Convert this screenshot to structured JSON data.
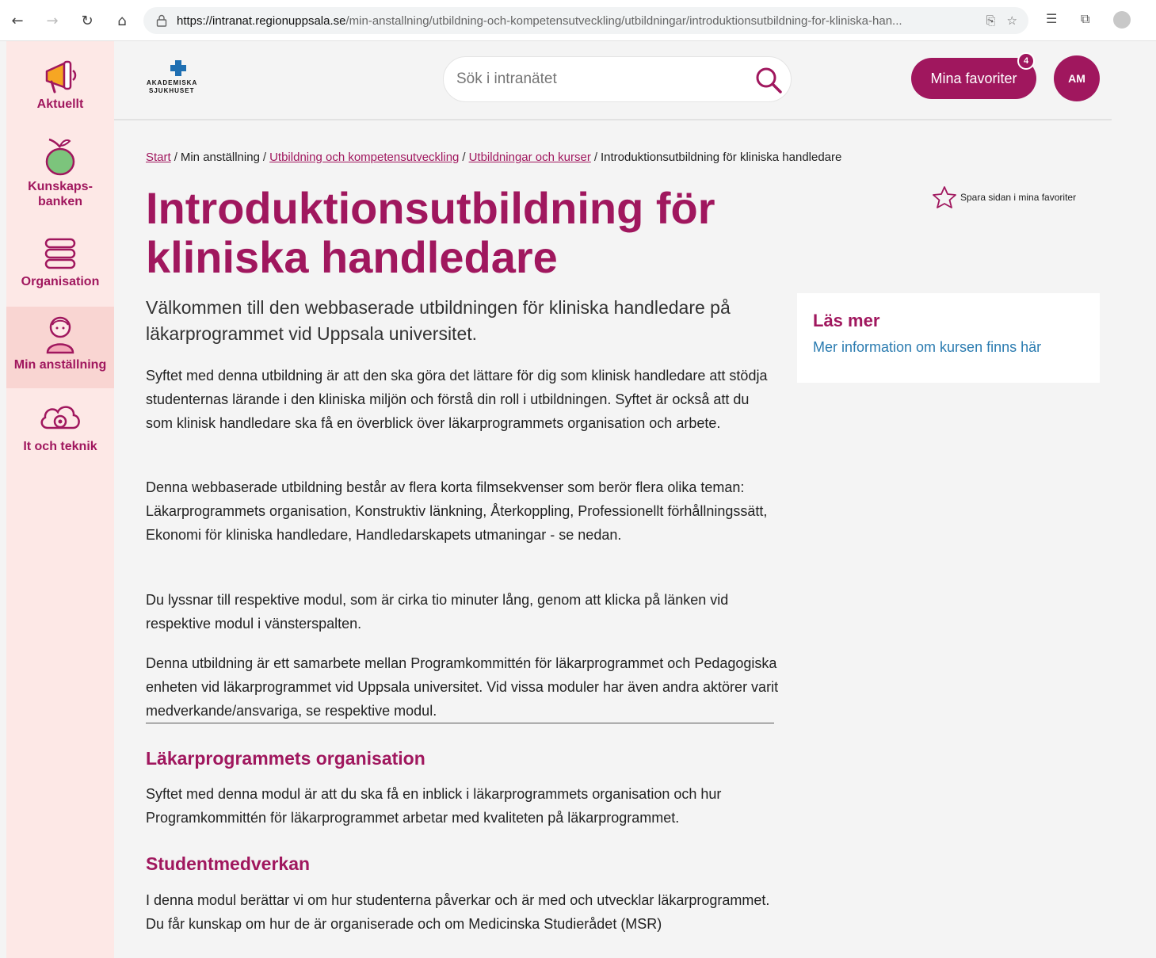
{
  "browser": {
    "url_host": "https://intranat.regionuppsala.se",
    "url_path": "/min-anstallning/utbildning-och-kompetensutveckling/utbildningar/introduktionsutbildning-for-kliniska-han..."
  },
  "rail": {
    "items": [
      {
        "label": "Aktuellt",
        "icon": "megaphone-icon"
      },
      {
        "label": "Kunskaps-\nbanken",
        "icon": "apple-icon"
      },
      {
        "label": "Organisation",
        "icon": "layers-icon"
      },
      {
        "label": "Min anställning",
        "icon": "person-icon"
      },
      {
        "label": "It och teknik",
        "icon": "cloud-gear-icon"
      }
    ],
    "active": "Min anställning"
  },
  "header": {
    "logo_line1": "AKADEMISKA",
    "logo_line2": "SJUKHUSET",
    "search_placeholder": "Sök i intranätet",
    "favorites_label": "Mina favoriter",
    "favorites_count": "4",
    "avatar_initials": "AM"
  },
  "breadcrumb": {
    "items": [
      {
        "label": "Start",
        "link": true
      },
      {
        "label": "Min anställning",
        "link": false
      },
      {
        "label": "Utbildning och kompetensutveckling",
        "link": true
      },
      {
        "label": "Utbildningar och kurser",
        "link": true
      },
      {
        "label": "Introduktionsutbildning för kliniska handledare",
        "link": false
      }
    ]
  },
  "page": {
    "save_favorite": "Spara sidan i mina favoriter",
    "title": "Introduktionsutbildning för kliniska handledare",
    "lead": "Välkommen till den webbaserade utbildningen för kliniska handledare på läkarprogrammet vid Uppsala universitet.",
    "paragraphs": [
      "Syftet med denna utbildning är att den ska göra det lättare för dig som klinisk handledare att stödja studenternas lärande i den kliniska miljön och förstå din roll i utbildningen. Syftet är också att du som klinisk handledare ska få en överblick över läkarprogrammets organisation och arbete.",
      "Denna webbaserade utbildning består av flera korta filmsekvenser som berör flera olika teman: Läkarprogrammets organisation, Konstruktiv länkning, Återkoppling, Professionellt förhållningssätt, Ekonomi för kliniska handledare, Handledarskapets utmaningar -  se nedan.",
      "Du lyssnar till respektive modul, som är cirka tio minuter lång, genom att klicka på länken vid respektive modul i vänsterspalten.",
      "Denna utbildning är ett samarbete mellan Programkommittén för läkarprogrammet och Pedagogiska enheten vid läkarprogrammet vid Uppsala universitet. Vid vissa moduler har även andra aktörer varit medverkande/ansvariga, se respektive modul."
    ],
    "sections": [
      {
        "heading": "Läkarprogrammets organisation",
        "text": "Syftet med denna modul är att du ska få en inblick i läkarprogrammets organisation och hur Programkommittén för läkarprogrammet arbetar med kvaliteten på läkarprogrammet."
      },
      {
        "heading": "Studentmedverkan",
        "text": "I denna modul berättar vi om hur studenterna påverkar och är med och utvecklar läkarprogrammet. Du får kunskap om hur de är organiserade och om Medicinska Studierådet (MSR)"
      }
    ]
  },
  "aside": {
    "title": "Läs mer",
    "link": "Mer information om kursen finns här"
  },
  "colors": {
    "brand": "#a0175e",
    "rail_bg": "#fde8e6",
    "rail_active": "#f9d5d2",
    "link": "#2a7bb0"
  }
}
